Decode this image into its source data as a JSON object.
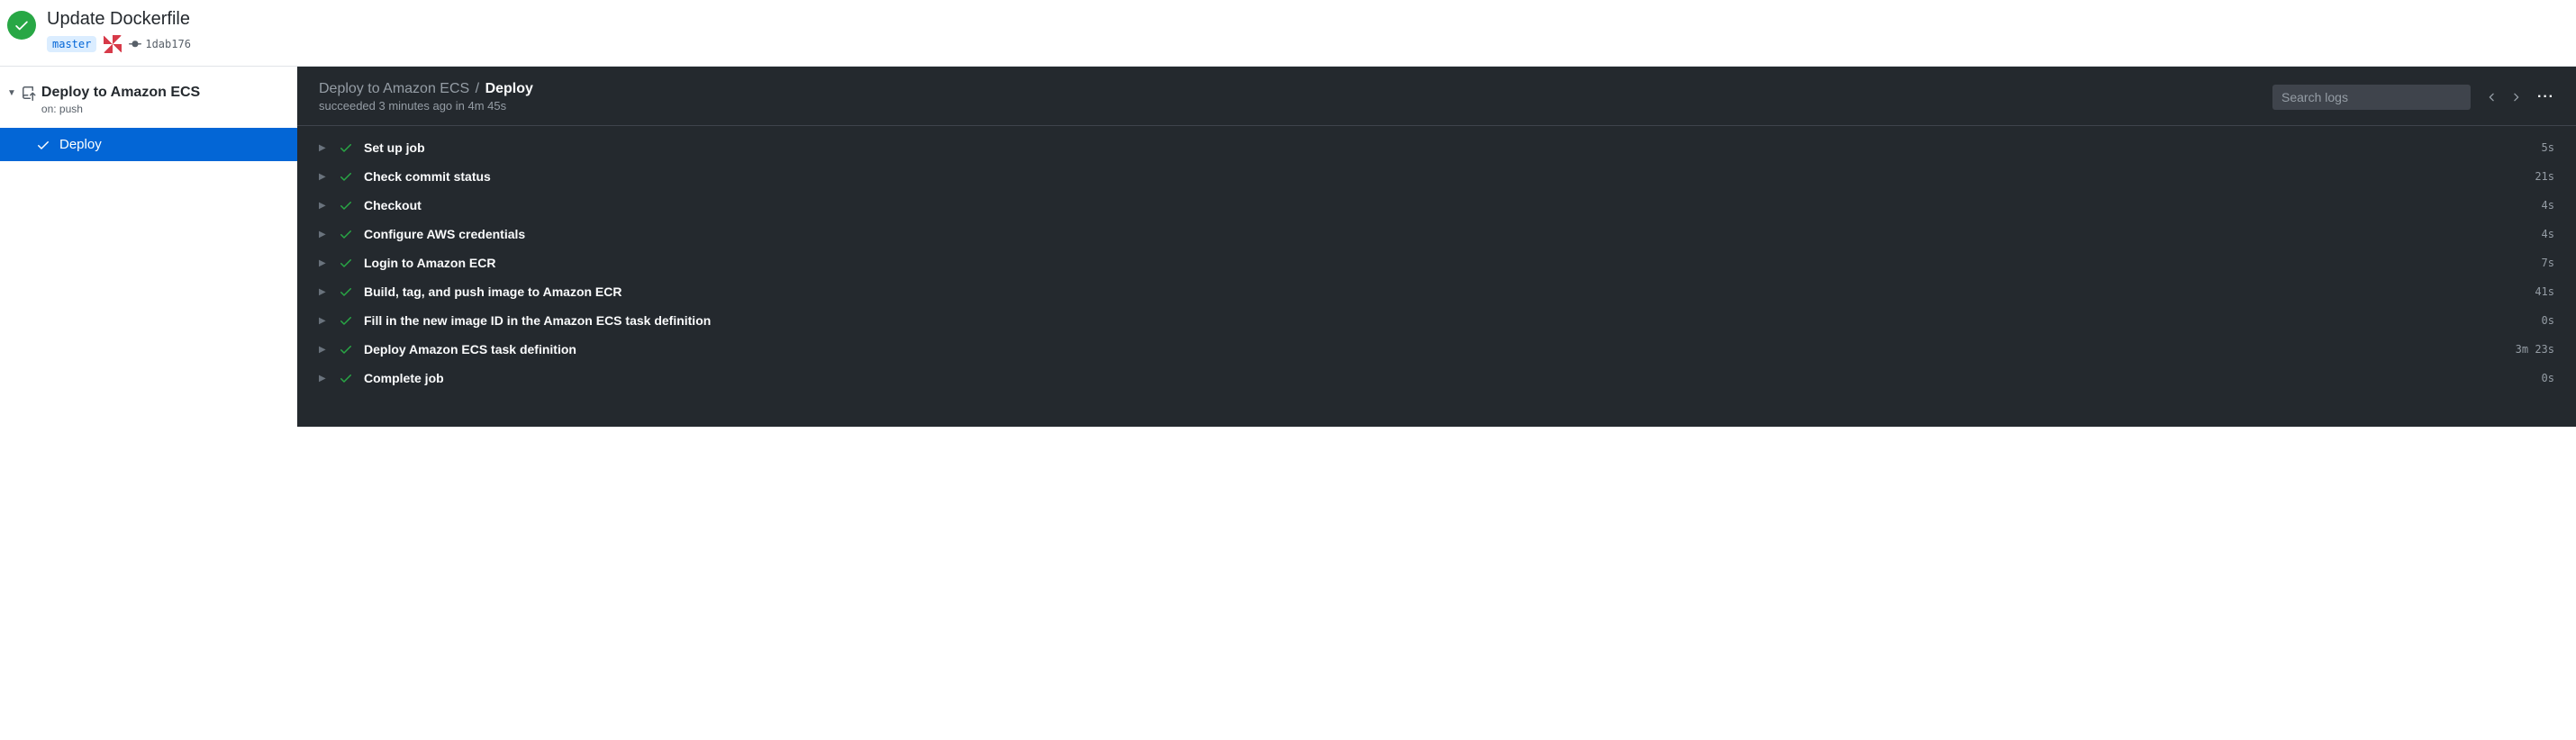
{
  "header": {
    "title": "Update Dockerfile",
    "branch": "master",
    "commit_sha": "1dab176"
  },
  "sidebar": {
    "workflow_name": "Deploy to Amazon ECS",
    "trigger_label": "on: push",
    "jobs": [
      {
        "name": "Deploy",
        "status": "success",
        "selected": true
      }
    ]
  },
  "main": {
    "breadcrumb_parent": "Deploy to Amazon ECS",
    "breadcrumb_current": "Deploy",
    "status_text": "succeeded 3 minutes ago in 4m 45s",
    "search_placeholder": "Search logs",
    "steps": [
      {
        "name": "Set up job",
        "duration": "5s",
        "status": "success"
      },
      {
        "name": "Check commit status",
        "duration": "21s",
        "status": "success"
      },
      {
        "name": "Checkout",
        "duration": "4s",
        "status": "success"
      },
      {
        "name": "Configure AWS credentials",
        "duration": "4s",
        "status": "success"
      },
      {
        "name": "Login to Amazon ECR",
        "duration": "7s",
        "status": "success"
      },
      {
        "name": "Build, tag, and push image to Amazon ECR",
        "duration": "41s",
        "status": "success"
      },
      {
        "name": "Fill in the new image ID in the Amazon ECS task definition",
        "duration": "0s",
        "status": "success"
      },
      {
        "name": "Deploy Amazon ECS task definition",
        "duration": "3m 23s",
        "status": "success"
      },
      {
        "name": "Complete job",
        "duration": "0s",
        "status": "success"
      }
    ]
  }
}
